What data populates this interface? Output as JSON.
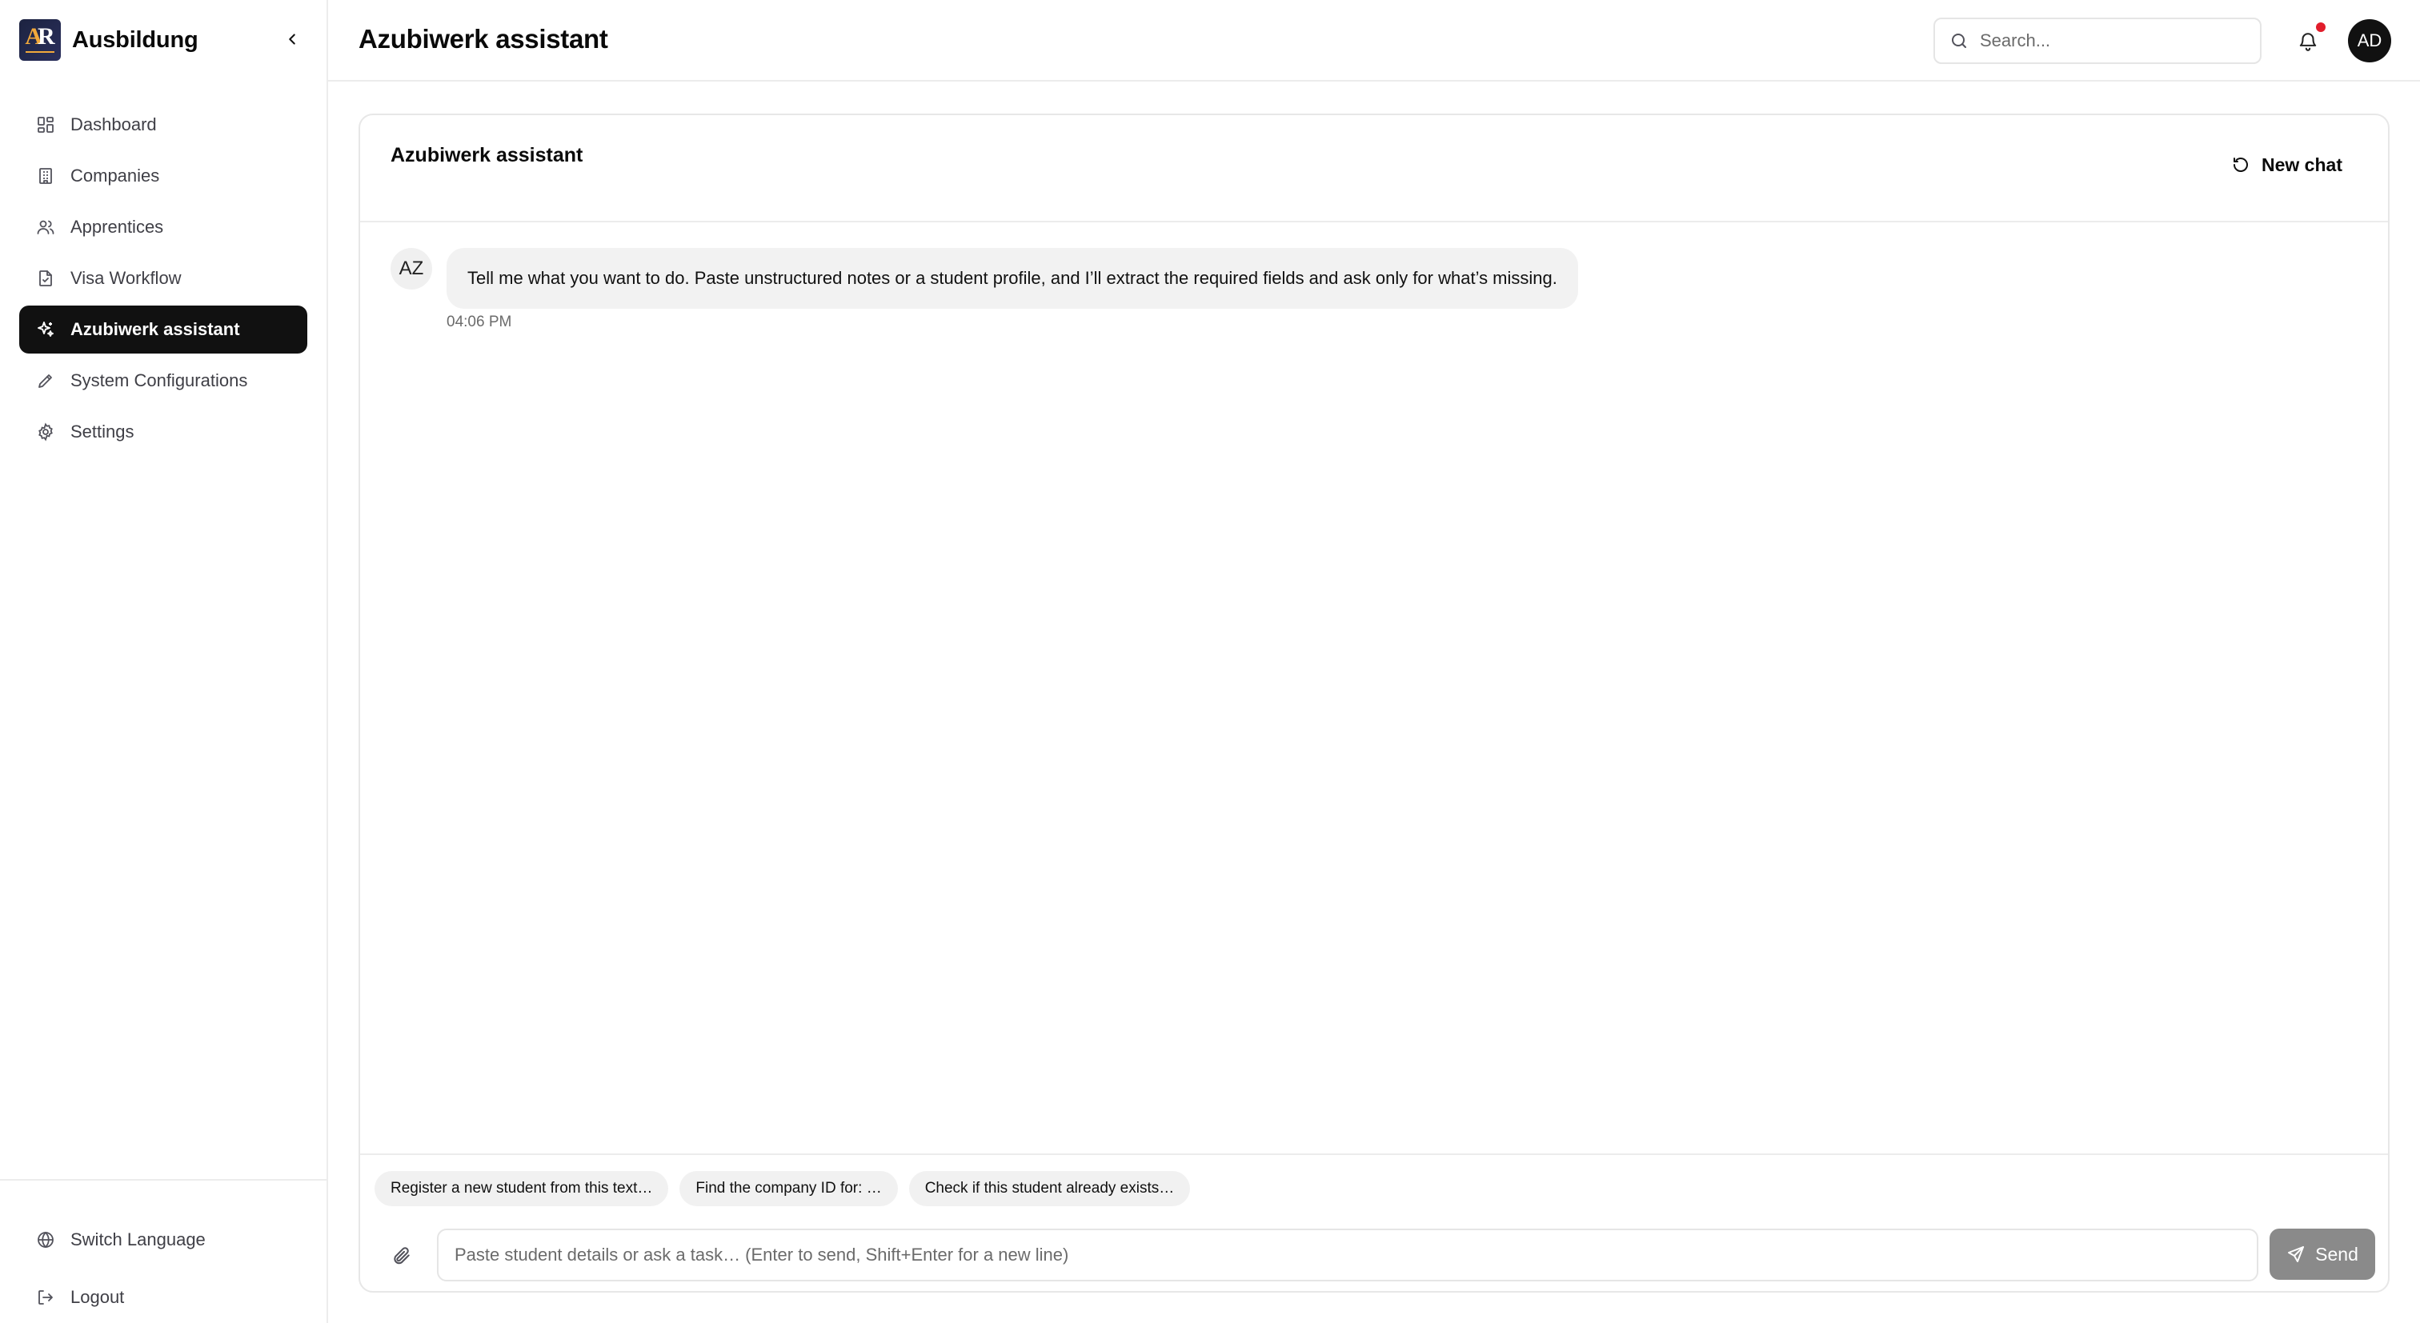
{
  "brand": {
    "name": "Ausbildung",
    "logo_icon": "ar-logo"
  },
  "sidebar": {
    "items": [
      {
        "label": "Dashboard",
        "icon": "grid-icon"
      },
      {
        "label": "Companies",
        "icon": "building-icon"
      },
      {
        "label": "Apprentices",
        "icon": "users-icon"
      },
      {
        "label": "Visa Workflow",
        "icon": "file-check-icon"
      },
      {
        "label": "Azubiwerk assistant",
        "icon": "sparkles-icon",
        "active": true
      },
      {
        "label": "System Configurations",
        "icon": "pencil-icon"
      },
      {
        "label": "Settings",
        "icon": "gear-icon"
      }
    ],
    "footer": {
      "switch_language": "Switch Language",
      "logout": "Logout"
    }
  },
  "header": {
    "title": "Azubiwerk assistant",
    "search_placeholder": "Search...",
    "avatar_initials": "AD",
    "notification_dot_color": "#e11d2b"
  },
  "chat": {
    "title": "Azubiwerk assistant",
    "new_chat_label": "New chat",
    "messages": [
      {
        "author_initials": "AZ",
        "text": "Tell me what you want to do. Paste unstructured notes or a student profile, and I’ll extract the required fields and ask only for what’s missing.",
        "time": "04:06 PM"
      }
    ],
    "suggestions": [
      "Register a new student from this text…",
      "Find the company ID for: …",
      "Check if this student already exists…"
    ],
    "input_placeholder": "Paste student details or ask a task… (Enter to send, Shift+Enter for a new line)",
    "send_label": "Send"
  },
  "colors": {
    "active_nav_bg": "#111111",
    "send_button_bg": "#8a8a8a"
  }
}
